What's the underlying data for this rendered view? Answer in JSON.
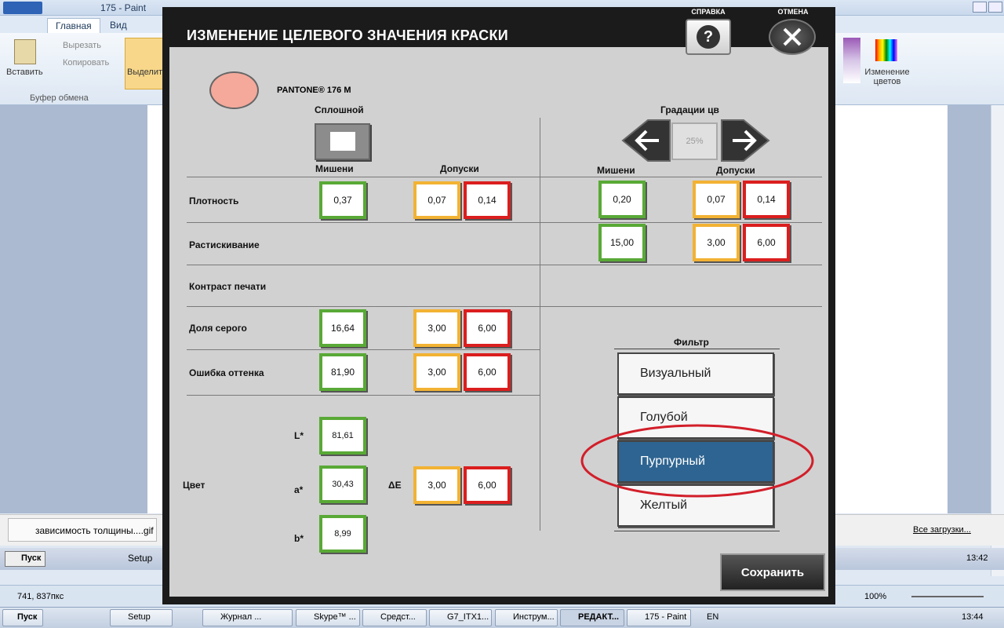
{
  "paint": {
    "window_title": "175 - Paint",
    "tabs": [
      "Главная",
      "Вид"
    ],
    "ribbon": {
      "paste": "Вставить",
      "cut": "Вырезать",
      "copy": "Копировать",
      "group_clipboard": "Буфер обмена",
      "select": "Выделит",
      "edit_colors": "Изменение цветов"
    },
    "download_item": "зависимость толщины....gif",
    "all_downloads": "Все загрузки...",
    "status_coords": "741, 837пкс",
    "zoom": "100%",
    "time_inner": "13:42"
  },
  "taskbar": {
    "start": "Пуск",
    "items": [
      "Setup",
      "Журнал ...",
      "Skype™ ...",
      "Средст...",
      "G7_ITX1...",
      "Инструм...",
      "РЕДАКТ...",
      "175 - Paint"
    ],
    "lang": "EN",
    "time": "13:44"
  },
  "dialog": {
    "title": "ИЗМЕНЕНИЕ ЦЕЛЕВОГО ЗНАЧЕНИЯ КРАСКИ",
    "help_label": "СПРАВКА",
    "help_icon": "?",
    "cancel_label": "ОТМЕНА",
    "color_name": "PANTONE® 176 M",
    "swatch_color": "#f4a99b",
    "solid_header": "Сплошной",
    "gradations_header": "Градации цв",
    "gradation_value": "25%",
    "targets": "Мишени",
    "tolerances": "Допуски",
    "rows": {
      "density": "Плотность",
      "dot_gain": "Растискивание",
      "print_contrast": "Контраст печати",
      "gray_share": "Доля серого",
      "hue_error": "Ошибка оттенка",
      "color": "Цвет"
    },
    "values": {
      "density_target": "0,37",
      "density_tol_y": "0,07",
      "density_tol_r": "0,14",
      "grad_density_target": "0,20",
      "grad_density_tol_y": "0,07",
      "grad_density_tol_r": "0,14",
      "grad_dotgain_target": "15,00",
      "grad_dotgain_tol_y": "3,00",
      "grad_dotgain_tol_r": "6,00",
      "gray_target": "16,64",
      "gray_tol_y": "3,00",
      "gray_tol_r": "6,00",
      "hue_target": "81,90",
      "hue_tol_y": "3,00",
      "hue_tol_r": "6,00",
      "L_label": "L*",
      "L_value": "81,61",
      "a_label": "a*",
      "a_value": "30,43",
      "b_label": "b*",
      "b_value": "8,99",
      "delta_e_label": "ΔE",
      "de_tol_y": "3,00",
      "de_tol_r": "6,00"
    },
    "filter": {
      "header": "Фильтр",
      "options": [
        "Визуальный",
        "Голубой",
        "Пурпурный",
        "Желтый"
      ],
      "selected": "Пурпурный"
    },
    "save": "Сохранить"
  },
  "colors": {
    "target_border": "#59a936",
    "warn_border": "#f2b233",
    "error_border": "#db1e1e",
    "selected_filter": "#2e6491",
    "annotation_ellipse": "#d21f2a"
  }
}
